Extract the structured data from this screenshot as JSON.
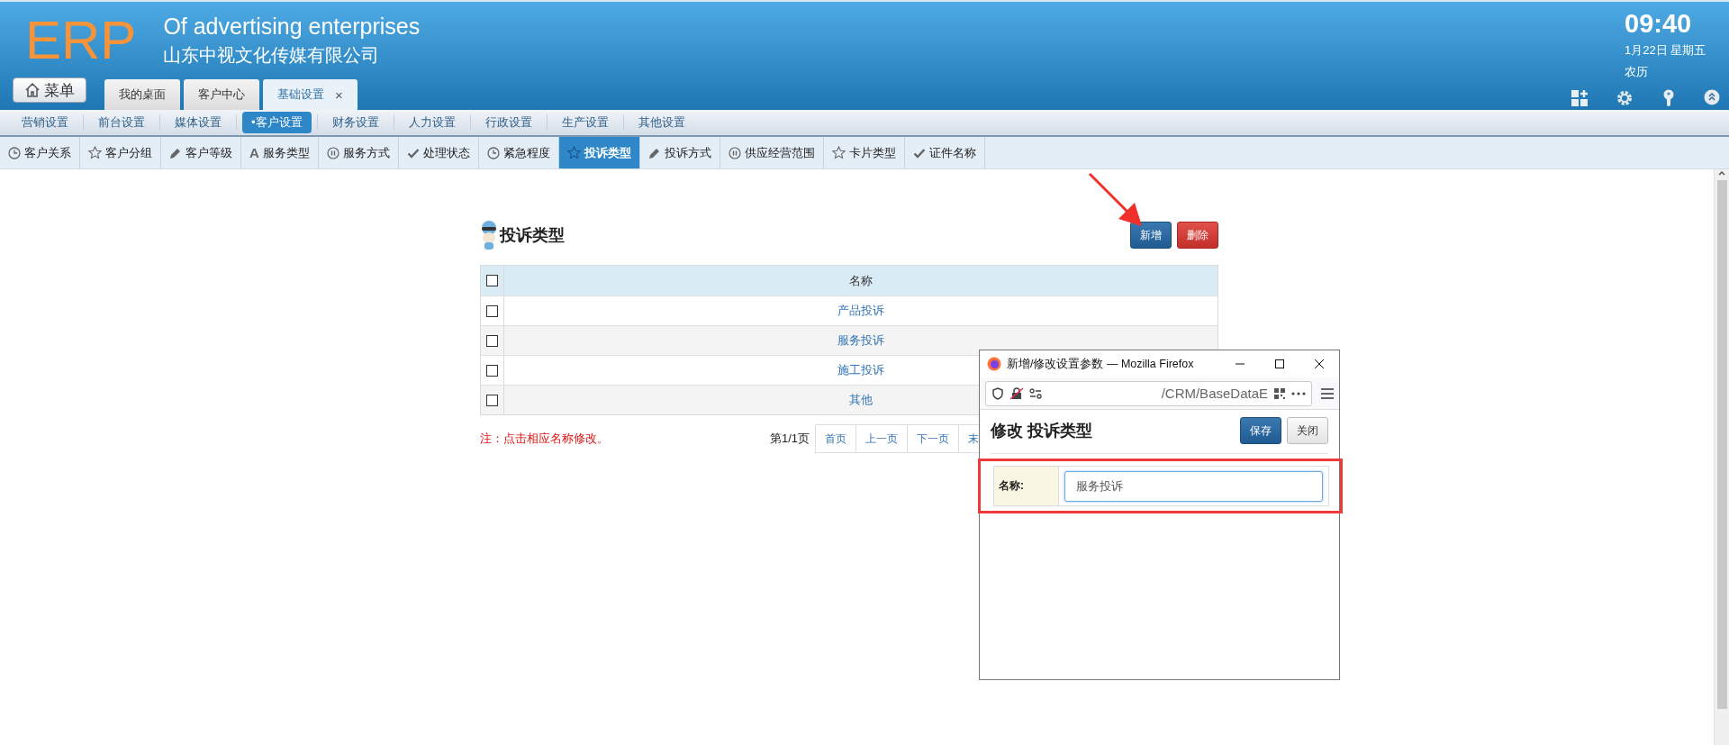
{
  "header": {
    "logo": "ERP",
    "title": "Of advertising enterprises",
    "company": "山东中视文化传媒有限公司",
    "clock": {
      "time": "09:40",
      "date": "1月22日 星期五",
      "lunar": "农历"
    }
  },
  "menu_button": "菜单",
  "tabs": [
    {
      "label": "我的桌面",
      "selected": false
    },
    {
      "label": "客户中心",
      "selected": false
    },
    {
      "label": "基础设置",
      "selected": true,
      "close": "×"
    }
  ],
  "nav": [
    {
      "label": "营销设置",
      "selected": false
    },
    {
      "label": "前台设置",
      "selected": false
    },
    {
      "label": "媒体设置",
      "selected": false
    },
    {
      "label": "•客户设置",
      "selected": true
    },
    {
      "label": "财务设置",
      "selected": false
    },
    {
      "label": "人力设置",
      "selected": false
    },
    {
      "label": "行政设置",
      "selected": false
    },
    {
      "label": "生产设置",
      "selected": false
    },
    {
      "label": "其他设置",
      "selected": false
    }
  ],
  "subtabs": [
    {
      "label": "客户关系",
      "kind": "clock",
      "selected": false
    },
    {
      "label": "客户分组",
      "kind": "star",
      "selected": false
    },
    {
      "label": "客户等级",
      "kind": "pencil",
      "selected": false
    },
    {
      "label": "服务类型",
      "kind": "glyph",
      "glyph": "A",
      "selected": false
    },
    {
      "label": "服务方式",
      "kind": "pause",
      "selected": false
    },
    {
      "label": "处理状态",
      "kind": "check",
      "selected": false
    },
    {
      "label": "紧急程度",
      "kind": "clock",
      "selected": false
    },
    {
      "label": "投诉类型",
      "kind": "star",
      "selected": true
    },
    {
      "label": "投诉方式",
      "kind": "pencil",
      "selected": false
    },
    {
      "label": "供应经营范围",
      "kind": "pause",
      "selected": false
    },
    {
      "label": "卡片类型",
      "kind": "star",
      "selected": false
    },
    {
      "label": "证件名称",
      "kind": "check",
      "selected": false
    }
  ],
  "panel": {
    "title": "投诉类型",
    "buttons": [
      {
        "label": "新增",
        "kind": "primary"
      },
      {
        "label": "删除",
        "kind": "danger"
      }
    ],
    "table": {
      "header_checked": false,
      "columns": [
        "名称"
      ],
      "rows": [
        {
          "name": "产品投诉",
          "checked": false
        },
        {
          "name": "服务投诉",
          "checked": false
        },
        {
          "name": "施工投诉",
          "checked": false
        },
        {
          "name": "其他",
          "checked": false
        }
      ]
    },
    "note": "注：点击相应名称修改。",
    "pagination": {
      "info": "第1/1页",
      "links": [
        "首页",
        "上一页",
        "下一页",
        "末"
      ]
    }
  },
  "popup": {
    "title": "新增/修改设置参数 — Mozilla Firefox",
    "url": "/CRM/BaseDataE",
    "heading": "修改 投诉类型",
    "buttons": [
      {
        "label": "保存",
        "kind": "primary"
      },
      {
        "label": "关闭",
        "kind": "default"
      }
    ],
    "field": {
      "label": "名称:",
      "value": "服务投诉"
    }
  }
}
